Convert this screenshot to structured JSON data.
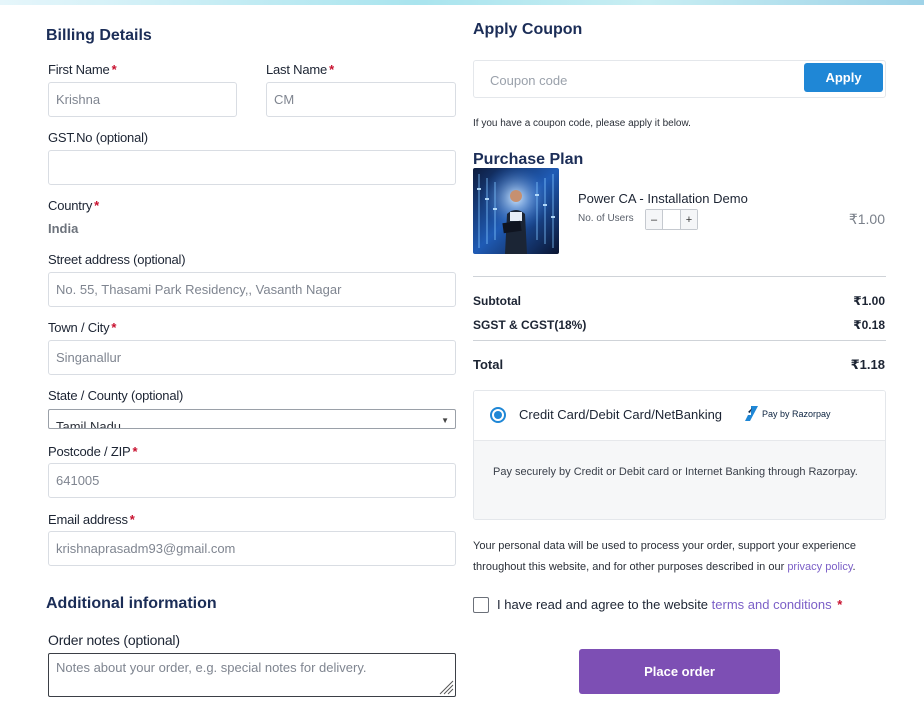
{
  "billing": {
    "title": "Billing Details",
    "first_name_label": "First Name",
    "first_name_value": "Krishna",
    "last_name_label": "Last Name",
    "last_name_value": "CM",
    "gst_label": "GST.No (optional)",
    "gst_value": "",
    "country_label": "Country",
    "country_value": "India",
    "street_label": "Street address (optional)",
    "street_value": "No. 55, Thasami Park Residency,, Vasanth Nagar",
    "town_label": "Town / City",
    "town_value": "Singanallur",
    "state_label": "State / County (optional)",
    "state_value": "Tamil Nadu",
    "postcode_label": "Postcode / ZIP",
    "postcode_value": "641005",
    "email_label": "Email address",
    "email_value": "krishnaprasadm93@gmail.com",
    "required_mark": "*"
  },
  "additional": {
    "title": "Additional information",
    "notes_label": "Order notes (optional)",
    "notes_placeholder": "Notes about your order, e.g. special notes for delivery."
  },
  "coupon": {
    "title": "Apply Coupon",
    "placeholder": "Coupon code",
    "apply_label": "Apply",
    "hint": "If you have a coupon code, please apply it below."
  },
  "plan": {
    "title": "Purchase Plan",
    "product_name": "Power CA - Installation Demo",
    "users_label": "No. of Users",
    "qty_minus": "–",
    "qty_plus": "+",
    "price": "₹1.00"
  },
  "summary": {
    "subtotal_label": "Subtotal",
    "subtotal_value": "₹1.00",
    "tax_label": "SGST & CGST(18%)",
    "tax_value": "₹0.18",
    "total_label": "Total",
    "total_value": "₹1.18"
  },
  "payment": {
    "method_label": "Credit Card/Debit Card/NetBanking",
    "brand_text": "Pay by Razorpay",
    "description": "Pay securely by Credit or Debit card or Internet Banking through Razorpay.",
    "selected": true
  },
  "legal": {
    "privacy_text": "Your personal data will be used to process your order, support your experience throughout this website, and for other purposes described in our",
    "privacy_link": "privacy policy",
    "privacy_end": ".",
    "agree_text": "I have read and agree to the website",
    "terms_link": "terms and conditions",
    "required_mark": "*"
  },
  "actions": {
    "place_order_label": "Place order"
  },
  "colors": {
    "accent_blue": "#1f87d6",
    "order_purple": "#7d4fb4",
    "link_purple": "#7b5fc7",
    "required_red": "#c8102e",
    "heading_navy": "#1b2d57"
  }
}
